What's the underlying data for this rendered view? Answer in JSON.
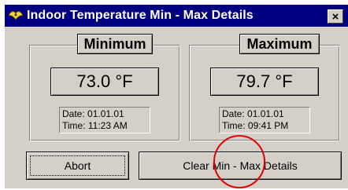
{
  "window": {
    "title": "Indoor Temperature Min - Max Details",
    "close_label": "×"
  },
  "minimum": {
    "heading": "Minimum",
    "value": "73.0 °F",
    "date_label": "Date:",
    "date": "01.01.01",
    "time_label": "Time:",
    "time": "11:23 AM"
  },
  "maximum": {
    "heading": "Maximum",
    "value": "79.7 °F",
    "date_label": "Date:",
    "date": "01.01.01",
    "time_label": "Time:",
    "time": "09:41 PM"
  },
  "buttons": {
    "abort_label": "Abort",
    "clear_label": "Clear Min - Max Details"
  },
  "icons": {
    "app": "app-icon",
    "close": "close-icon"
  },
  "colors": {
    "titlebar": "#000080",
    "face": "#d4d0c8",
    "annotation_circle": "#e00000"
  }
}
